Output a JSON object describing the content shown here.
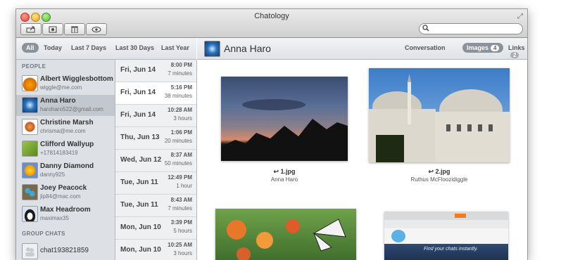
{
  "app": {
    "title": "Chatology"
  },
  "filters": [
    "All",
    "Today",
    "Last 7 Days",
    "Last 30 Days",
    "Last Year"
  ],
  "sidebar": {
    "people_label": "PEOPLE",
    "people": [
      {
        "name": "Albert Wigglesbottom",
        "email": "wiggle@me.com"
      },
      {
        "name": "Anna Haro",
        "email": "haroharo522@gmail.com"
      },
      {
        "name": "Christine Marsh",
        "email": "chrisma@me.com"
      },
      {
        "name": "Clifford Wallyup",
        "email": "+17814183419"
      },
      {
        "name": "Danny Diamond",
        "email": "danny925"
      },
      {
        "name": "Joey Peacock",
        "email": "jlp84@mac.com"
      },
      {
        "name": "Max Headroom",
        "email": "maximax35"
      }
    ],
    "group_label": "GROUP CHATS",
    "groups": [
      {
        "name": "chat193821859"
      }
    ]
  },
  "dates": [
    {
      "day": "Fri, Jun 14",
      "time": "8:00 PM",
      "duration": "7 minutes"
    },
    {
      "day": "Fri, Jun 14",
      "time": "5:16 PM",
      "duration": "38 minutes"
    },
    {
      "day": "Fri, Jun 14",
      "time": "10:28 AM",
      "duration": "3 hours"
    },
    {
      "day": "Thu, Jun 13",
      "time": "1:06 PM",
      "duration": "20 minutes"
    },
    {
      "day": "Wed, Jun 12",
      "time": "8:37 AM",
      "duration": "50 minutes"
    },
    {
      "day": "Tue, Jun 11",
      "time": "12:49 PM",
      "duration": "1 hour"
    },
    {
      "day": "Tue, Jun 11",
      "time": "8:43 AM",
      "duration": "7 minutes"
    },
    {
      "day": "Mon, Jun 10",
      "time": "3:39 PM",
      "duration": "5 hours"
    },
    {
      "day": "Mon, Jun 10",
      "time": "10:25 AM",
      "duration": "3 hours"
    }
  ],
  "main": {
    "contact_name": "Anna Haro",
    "tabs": [
      {
        "label": "Conversation",
        "count": ""
      },
      {
        "label": "Images",
        "count": "4"
      },
      {
        "label": "Links",
        "count": "2"
      }
    ],
    "images": [
      {
        "file": "1.jpg",
        "sender": "Anna Haro"
      },
      {
        "file": "2.jpg",
        "sender": "Ruthus McFloozidiggle"
      }
    ],
    "screenshot_text": "Find your chats instantly."
  }
}
